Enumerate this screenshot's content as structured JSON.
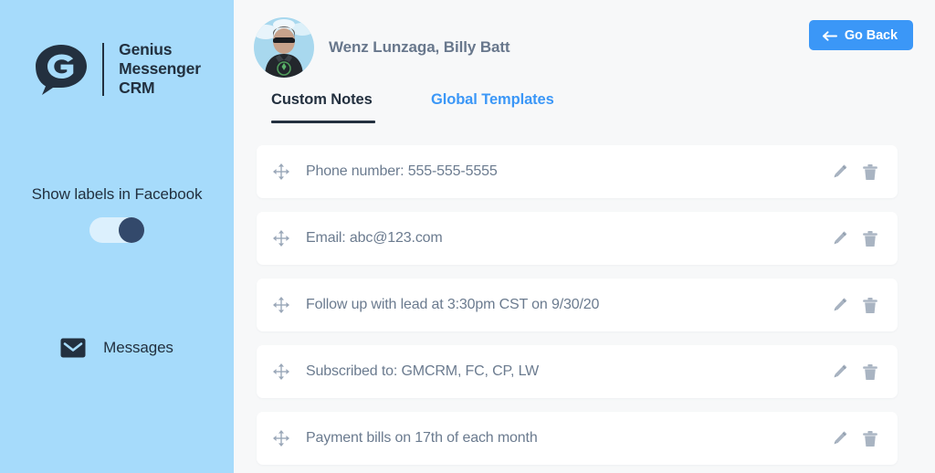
{
  "sidebar": {
    "brand": {
      "logo_icon": "speech-bubble-g-logo",
      "line1": "Genius",
      "line2": "Messenger",
      "line3": "CRM"
    },
    "toggle": {
      "label": "Show labels in Facebook",
      "state": "on"
    },
    "nav_items": [
      {
        "icon": "envelope-icon",
        "label": "Messages"
      }
    ],
    "background_color": "#a6dbfb"
  },
  "header": {
    "avatar_alt": "contact-avatar",
    "contact_name": "Wenz Lunzaga, Billy Batt",
    "go_back": {
      "label": "Go Back",
      "icon": "arrow-left-icon",
      "color": "#3b97f7"
    }
  },
  "tabs": [
    {
      "label": "Custom Notes",
      "active": true,
      "color": "#23303f"
    },
    {
      "label": "Global Templates",
      "active": false,
      "color": "#3b97f7"
    }
  ],
  "notes": {
    "row_icons": {
      "drag": "move-arrows-icon",
      "edit": "pencil-icon",
      "delete": "trash-icon"
    },
    "items": [
      {
        "text": "Phone number: 555-555-5555"
      },
      {
        "text": "Email: abc@123.com"
      },
      {
        "text": "Follow up with lead at 3:30pm CST on 9/30/20"
      },
      {
        "text": "Subscribed to: GMCRM, FC, CP, LW"
      },
      {
        "text": "Payment bills on 17th of each month"
      }
    ]
  },
  "colors": {
    "accent_blue": "#3b97f7",
    "sidebar_blue": "#a6dbfb",
    "dark_navy": "#23303f",
    "body_bg": "#f7f8f9",
    "muted_text": "#6b7b8f"
  }
}
